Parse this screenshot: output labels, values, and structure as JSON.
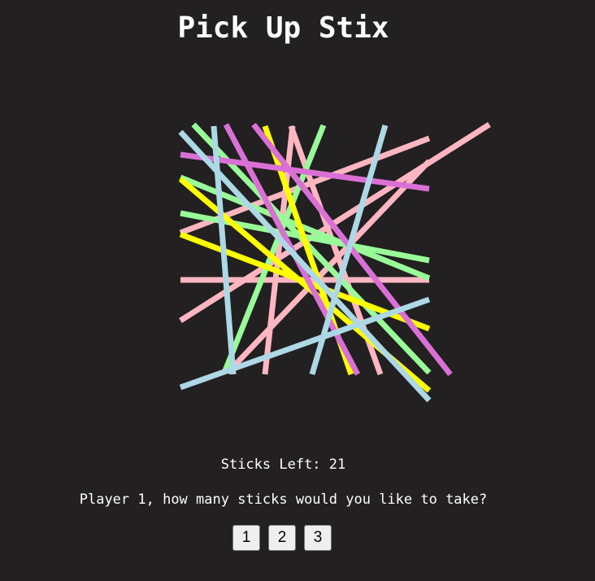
{
  "game": {
    "title": "Pick Up Stix",
    "sticks_left_label": "Sticks Left:",
    "sticks_left": 21,
    "prompt": "Player 1, how many sticks would you like to take?",
    "choices": [
      "1",
      "2",
      "3"
    ]
  },
  "colors": {
    "background": "#222021",
    "stick_palette": [
      "#ffb6c1",
      "#98fb98",
      "#add8e6",
      "#da70d6",
      "#ffff00"
    ]
  }
}
